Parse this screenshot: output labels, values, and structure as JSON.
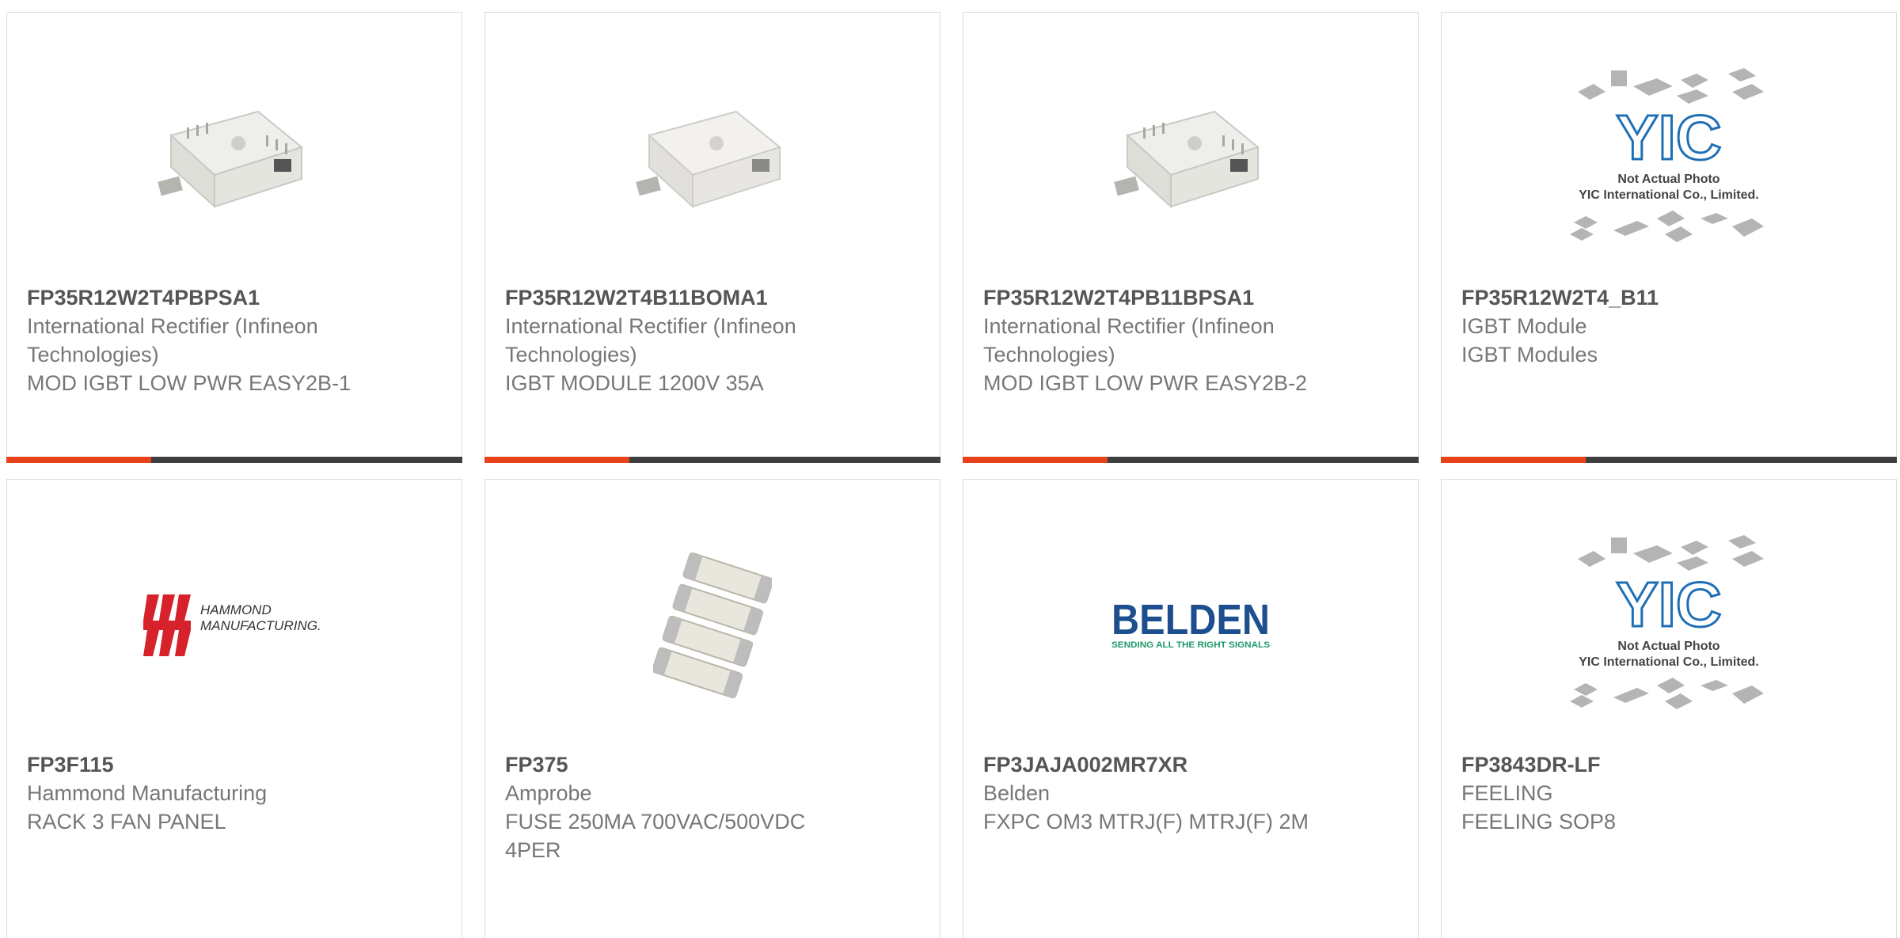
{
  "colors": {
    "accent": "#e8421a",
    "bar_dark": "#3f3f3f",
    "text": "#777777",
    "title": "#555555"
  },
  "products": [
    {
      "part_number": "FP35R12W2T4PBPSA1",
      "manufacturer": "International Rectifier (Infineon Technologies)",
      "description": "MOD IGBT LOW PWR EASY2B-1",
      "image": "igbt-module-photo",
      "accent_bar_fraction": 0.32
    },
    {
      "part_number": "FP35R12W2T4B11BOMA1",
      "manufacturer": "International Rectifier (Infineon Technologies)",
      "description": "IGBT MODULE 1200V 35A",
      "image": "igbt-module-photo",
      "accent_bar_fraction": 0.32
    },
    {
      "part_number": "FP35R12W2T4PB11BPSA1",
      "manufacturer": "International Rectifier (Infineon Technologies)",
      "description": "MOD IGBT LOW PWR EASY2B-2",
      "image": "igbt-module-photo",
      "accent_bar_fraction": 0.32
    },
    {
      "part_number": "FP35R12W2T4_B11",
      "manufacturer": "IGBT Module",
      "description": "IGBT Modules",
      "image": "placeholder-photo",
      "accent_bar_fraction": 0.32
    },
    {
      "part_number": "FP3F115",
      "manufacturer": "Hammond Manufacturing",
      "description": "RACK 3 FAN PANEL",
      "image": "hammond-logo"
    },
    {
      "part_number": "FP375",
      "manufacturer": "Amprobe",
      "description": "FUSE 250MA 700VAC/500VDC 4PER",
      "image": "fuse-photo"
    },
    {
      "part_number": "FP3JAJA002MR7XR",
      "manufacturer": "Belden",
      "description": "FXPC OM3 MTRJ(F) MTRJ(F) 2M",
      "image": "belden-logo"
    },
    {
      "part_number": "FP3843DR-LF",
      "manufacturer": "FEELING",
      "description": "FEELING SOP8",
      "image": "placeholder-photo"
    }
  ],
  "images": {
    "placeholder": {
      "brand": "YIC",
      "line1": "Not Actual Photo",
      "line2": "YIC International Co., Limited."
    },
    "hammond": {
      "line1": "HAMMOND",
      "line2": "MANUFACTURING."
    },
    "belden": {
      "brand": "BELDEN",
      "tagline": "SENDING ALL THE RIGHT SIGNALS"
    }
  }
}
